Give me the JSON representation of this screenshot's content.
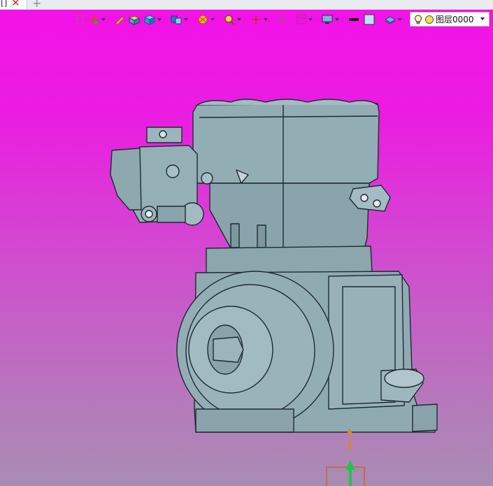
{
  "tabs": {
    "doc_label": "[]",
    "close_glyph": "✕",
    "new_glyph": "+"
  },
  "toolbar": {
    "buttons": [
      {
        "icon": "sketch-exit-icon",
        "has_dropdown": false
      },
      {
        "icon": "feature-tools-icon",
        "has_dropdown": true
      },
      {
        "icon": "pen-draw-icon",
        "has_dropdown": false
      },
      {
        "icon": "box-solid-icon",
        "has_dropdown": false
      },
      {
        "icon": "cube-shaded-icon",
        "has_dropdown": true
      },
      {
        "icon": "view-orientation-icon",
        "has_dropdown": true
      },
      {
        "icon": "render-style-icon",
        "has_dropdown": true
      },
      {
        "icon": "zoom-icon",
        "has_dropdown": true
      },
      {
        "icon": "triad-axes-icon",
        "has_dropdown": true
      },
      {
        "icon": "section-view-icon",
        "has_dropdown": false
      },
      {
        "icon": "layout-frame-icon",
        "has_dropdown": true
      },
      {
        "icon": "monitor-display-icon",
        "has_dropdown": true
      },
      {
        "icon": "line-color-icon",
        "has_dropdown": false
      },
      {
        "icon": "fill-color-icon",
        "has_dropdown": false
      },
      {
        "icon": "layer-stack-icon",
        "has_dropdown": true
      }
    ],
    "layer": {
      "value": "图层0000",
      "bulb_icon": "lightbulb-icon",
      "status_icon": "layer-status-dot-icon"
    }
  },
  "colors": {
    "background_top": "#f410e8",
    "background_bottom": "#a98cb3",
    "model_fill": "#8fa9b1",
    "model_edge": "#1e2a30",
    "triad_up": "#22c54a",
    "triad_origin": "#e0822a"
  }
}
